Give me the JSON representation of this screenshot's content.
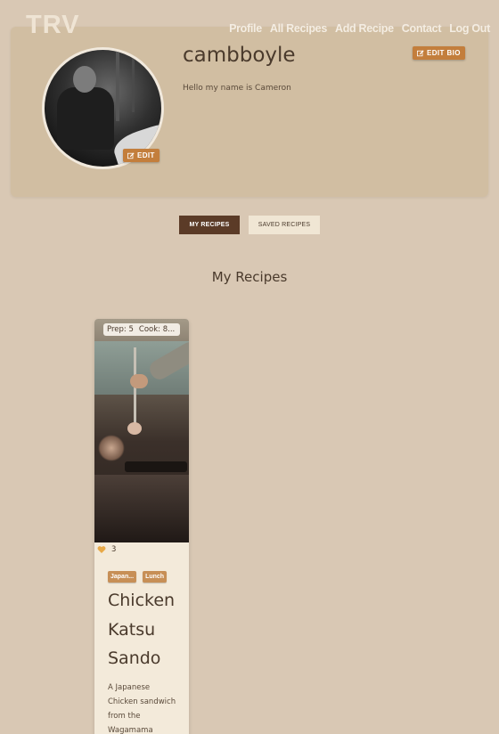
{
  "brand": {
    "logo": "TRV"
  },
  "nav": {
    "items": [
      {
        "label": "Profile"
      },
      {
        "label": "All Recipes"
      },
      {
        "label": "Add Recipe"
      },
      {
        "label": "Contact"
      },
      {
        "label": "Log Out"
      }
    ]
  },
  "profile": {
    "username": "cambboyle",
    "bio": "Hello my name is Cameron",
    "edit_avatar_label": "EDIT",
    "edit_bio_label": "EDIT BIO",
    "edit_icon": "edit-icon"
  },
  "tabs": {
    "active_label": "MY RECIPES",
    "inactive_label": "SAVED RECIPES"
  },
  "section": {
    "title": "My Recipes"
  },
  "recipes": [
    {
      "prep": "Prep: 5",
      "cook": "Cook: 8...",
      "likes": "3",
      "like_icon": "heart-icon",
      "tags": [
        "Japan...",
        "Lunch"
      ],
      "title": "Chicken Katsu Sando",
      "description": "A Japanese Chicken sandwich from the Wagamama"
    }
  ],
  "colors": {
    "background": "#d9c8b4",
    "card": "#d1bea2",
    "accent": "#c37e3c",
    "tab_active": "#5b3b27"
  }
}
